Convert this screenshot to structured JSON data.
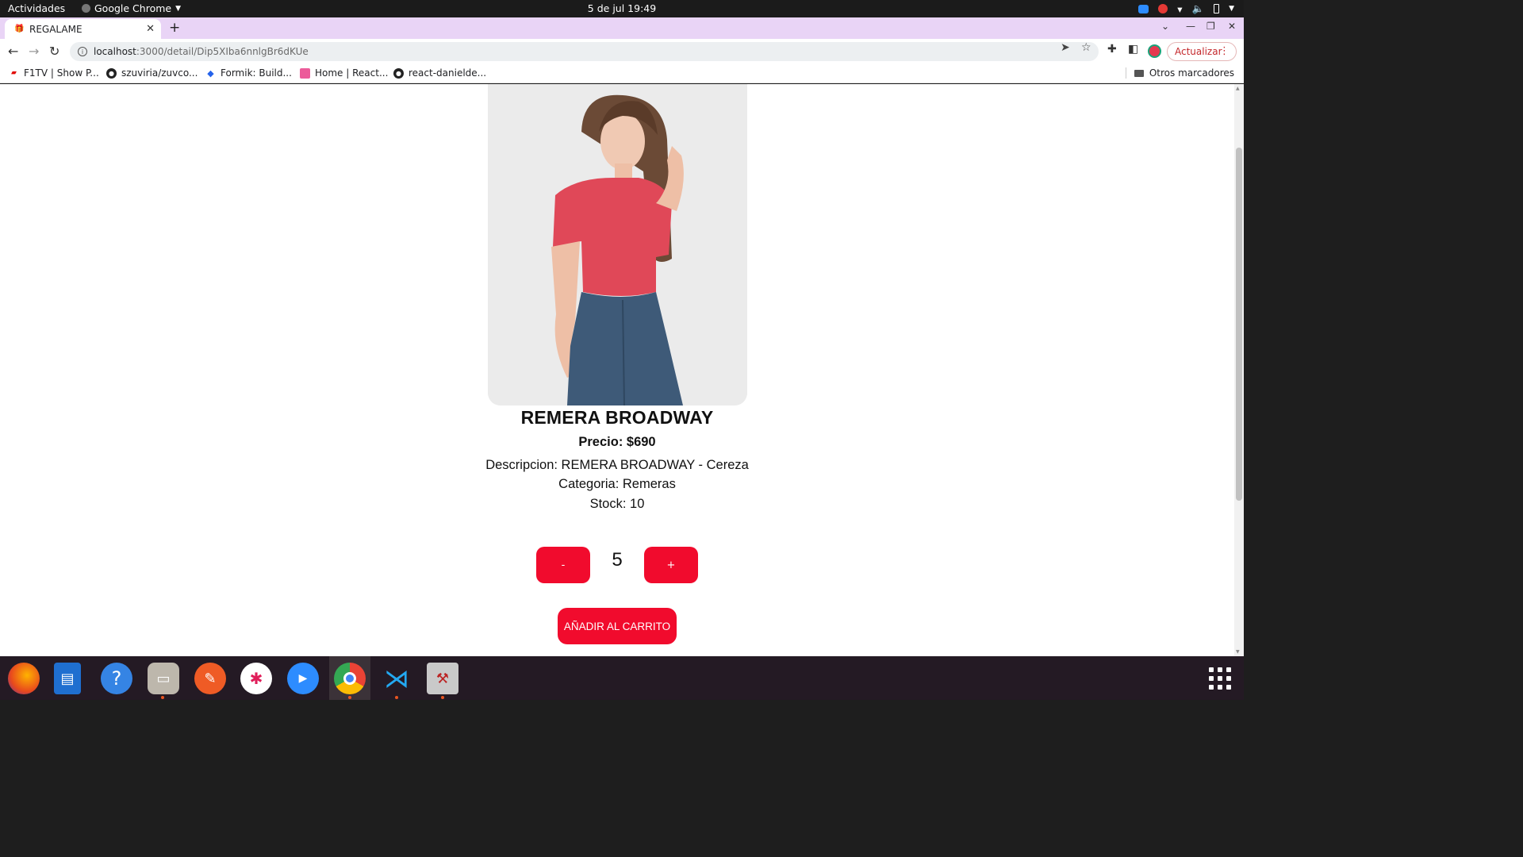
{
  "system": {
    "activities": "Actividades",
    "app_name": "Google Chrome",
    "clock": "5 de jul  19:49"
  },
  "browser": {
    "tab_title": "REGALAME",
    "url_host": "localhost",
    "url_rest": ":3000/detail/Dip5XIba6nnlgBr6dKUe",
    "update_label": "Actualizar",
    "bookmarks": [
      {
        "label": "F1TV | Show P...",
        "icon": "f1-icon"
      },
      {
        "label": "szuviria/zuvco...",
        "icon": "github-icon"
      },
      {
        "label": "Formik: Build...",
        "icon": "formik-icon"
      },
      {
        "label": "Home | React...",
        "icon": "react-icon"
      },
      {
        "label": "react-danielde...",
        "icon": "github-icon"
      }
    ],
    "other_bookmarks": "Otros marcadores"
  },
  "product": {
    "name": "REMERA BROADWAY",
    "price": "Precio: $690",
    "description": "Descripcion: REMERA BROADWAY - Cereza",
    "category": "Categoria: Remeras",
    "stock": "Stock: 10",
    "decrement_label": "-",
    "quantity": "5",
    "increment_label": "+",
    "add_to_cart": "AÑADIR AL CARRITO",
    "colors": {
      "accent": "#f10b2d",
      "shirt": "#e04858",
      "jeans": "#3e5a78"
    }
  },
  "dock": {
    "apps": [
      "firefox-icon",
      "writer-icon",
      "help-icon",
      "files-icon",
      "postman-icon",
      "slack-icon",
      "zoom-icon",
      "chrome-icon",
      "vscode-icon",
      "tool-icon"
    ]
  }
}
